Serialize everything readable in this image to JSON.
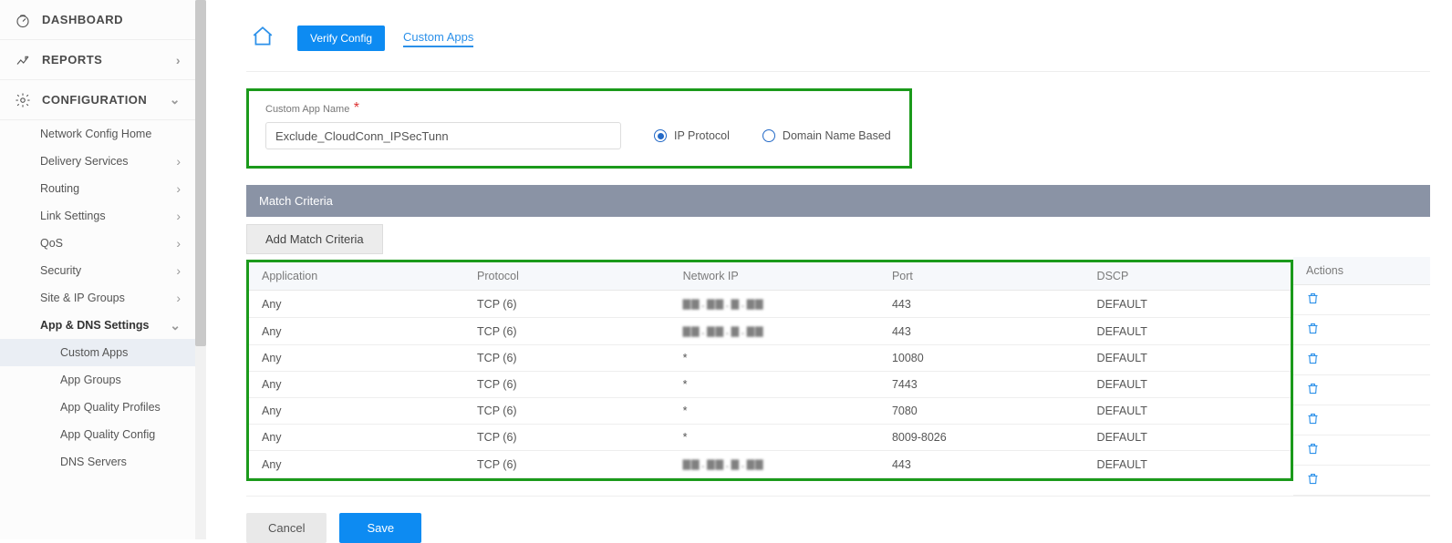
{
  "sidebar": {
    "dashboard": "DASHBOARD",
    "reports": "REPORTS",
    "configuration": "CONFIGURATION",
    "items": [
      {
        "label": "Network Config Home",
        "expandable": false
      },
      {
        "label": "Delivery Services",
        "expandable": true
      },
      {
        "label": "Routing",
        "expandable": true
      },
      {
        "label": "Link Settings",
        "expandable": true
      },
      {
        "label": "QoS",
        "expandable": true
      },
      {
        "label": "Security",
        "expandable": true
      },
      {
        "label": "Site & IP Groups",
        "expandable": true
      },
      {
        "label": "App & DNS Settings",
        "expandable": true,
        "expanded": true
      }
    ],
    "subitems": [
      {
        "label": "Custom Apps",
        "active": true
      },
      {
        "label": "App Groups"
      },
      {
        "label": "App Quality Profiles"
      },
      {
        "label": "App Quality Config"
      },
      {
        "label": "DNS Servers"
      }
    ]
  },
  "topbar": {
    "verify": "Verify Config",
    "crumb": "Custom Apps"
  },
  "form": {
    "label": "Custom App Name",
    "value": "Exclude_CloudConn_IPSecTunn",
    "radio1": "IP Protocol",
    "radio2": "Domain Name Based",
    "selected_radio": "ip"
  },
  "match": {
    "header": "Match Criteria",
    "add": "Add Match Criteria",
    "columns": {
      "app": "Application",
      "proto": "Protocol",
      "net": "Network IP",
      "port": "Port",
      "dscp": "DSCP",
      "actions": "Actions"
    },
    "rows": [
      {
        "app": "Any",
        "proto": "TCP (6)",
        "net": "obscured",
        "port": "443",
        "dscp": "DEFAULT"
      },
      {
        "app": "Any",
        "proto": "TCP (6)",
        "net": "obscured",
        "port": "443",
        "dscp": "DEFAULT"
      },
      {
        "app": "Any",
        "proto": "TCP (6)",
        "net": "*",
        "port": "10080",
        "dscp": "DEFAULT"
      },
      {
        "app": "Any",
        "proto": "TCP (6)",
        "net": "*",
        "port": "7443",
        "dscp": "DEFAULT"
      },
      {
        "app": "Any",
        "proto": "TCP (6)",
        "net": "*",
        "port": "7080",
        "dscp": "DEFAULT"
      },
      {
        "app": "Any",
        "proto": "TCP (6)",
        "net": "*",
        "port": "8009-8026",
        "dscp": "DEFAULT"
      },
      {
        "app": "Any",
        "proto": "TCP (6)",
        "net": "obscured",
        "port": "443",
        "dscp": "DEFAULT"
      }
    ]
  },
  "footer": {
    "cancel": "Cancel",
    "save": "Save"
  }
}
